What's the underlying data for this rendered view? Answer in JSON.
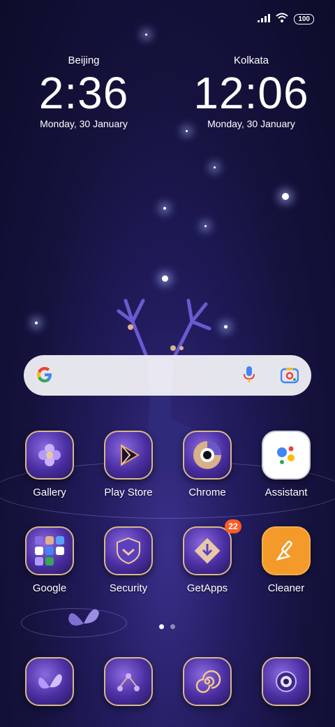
{
  "status_bar": {
    "battery": "100",
    "icons": [
      "signal-icon",
      "wifi-icon",
      "battery-icon"
    ]
  },
  "clocks": [
    {
      "city": "Beijing",
      "time": "2:36",
      "date": "Monday, 30 January"
    },
    {
      "city": "Kolkata",
      "time": "12:06",
      "date": "Monday, 30 January"
    }
  ],
  "search_bar": {
    "icons": [
      "google-g-icon",
      "microphone-icon",
      "lens-camera-icon"
    ]
  },
  "apps_row1": [
    {
      "label": "Gallery",
      "icon": "flower-icon"
    },
    {
      "label": "Play Store",
      "icon": "play-icon"
    },
    {
      "label": "Chrome",
      "icon": "chrome-icon"
    },
    {
      "label": "Assistant",
      "icon": "assistant-icon"
    }
  ],
  "apps_row2": [
    {
      "label": "Google",
      "icon": "folder-icon"
    },
    {
      "label": "Security",
      "icon": "shield-icon"
    },
    {
      "label": "GetApps",
      "icon": "getapps-icon",
      "badge": "22"
    },
    {
      "label": "Cleaner",
      "icon": "broom-icon"
    }
  ],
  "dock": [
    {
      "icon": "butterfly-icon"
    },
    {
      "icon": "contacts-icon"
    },
    {
      "icon": "spiral-icon"
    },
    {
      "icon": "camera-icon"
    }
  ],
  "page_indicator": {
    "pages": 2,
    "active": 1
  }
}
